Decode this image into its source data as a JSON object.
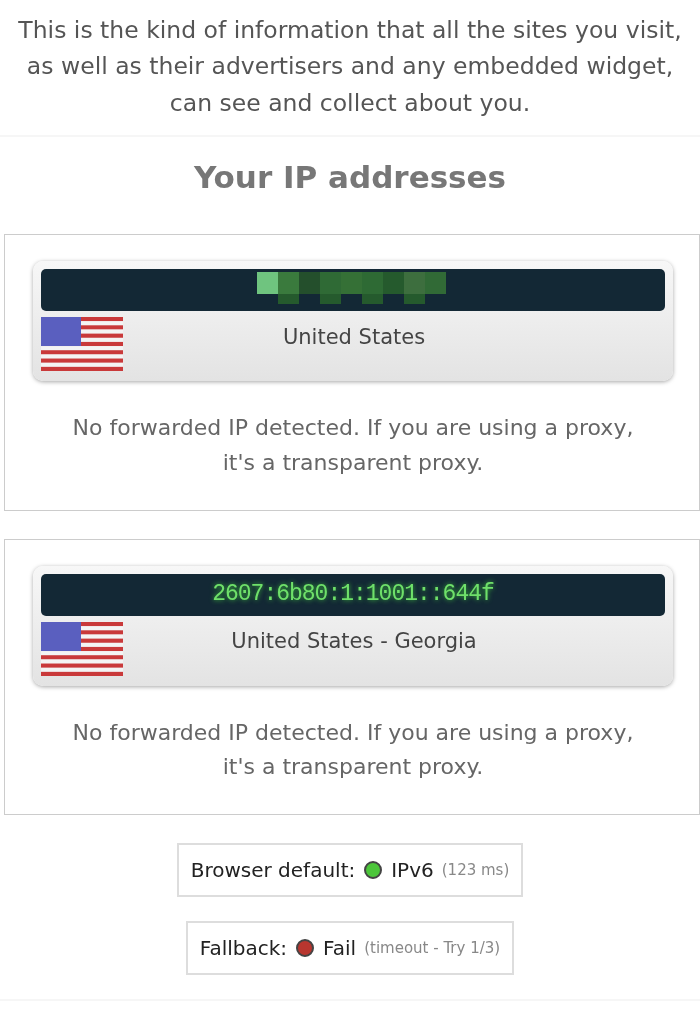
{
  "intro": "This is the kind of information that all the sites you visit, as well as their advertisers and any embedded widget, can see and collect about you.",
  "heading": "Your IP addresses",
  "entries": [
    {
      "redacted": true,
      "country": "United States",
      "note": "No forwarded IP detected. If you are using a proxy, it's a transparent proxy."
    },
    {
      "redacted": false,
      "address": "2607:6b80:1:1001::644f",
      "country": "United States - Georgia",
      "note": "No forwarded IP detected. If you are using a proxy, it's a transparent proxy."
    }
  ],
  "checks": [
    {
      "label": "Browser default:",
      "color": "#4cc63a",
      "result": "IPv6",
      "detail": "(123 ms)"
    },
    {
      "label": "Fallback:",
      "color": "#b8362f",
      "result": "Fail",
      "detail": "(timeout - Try 1/3)"
    }
  ]
}
